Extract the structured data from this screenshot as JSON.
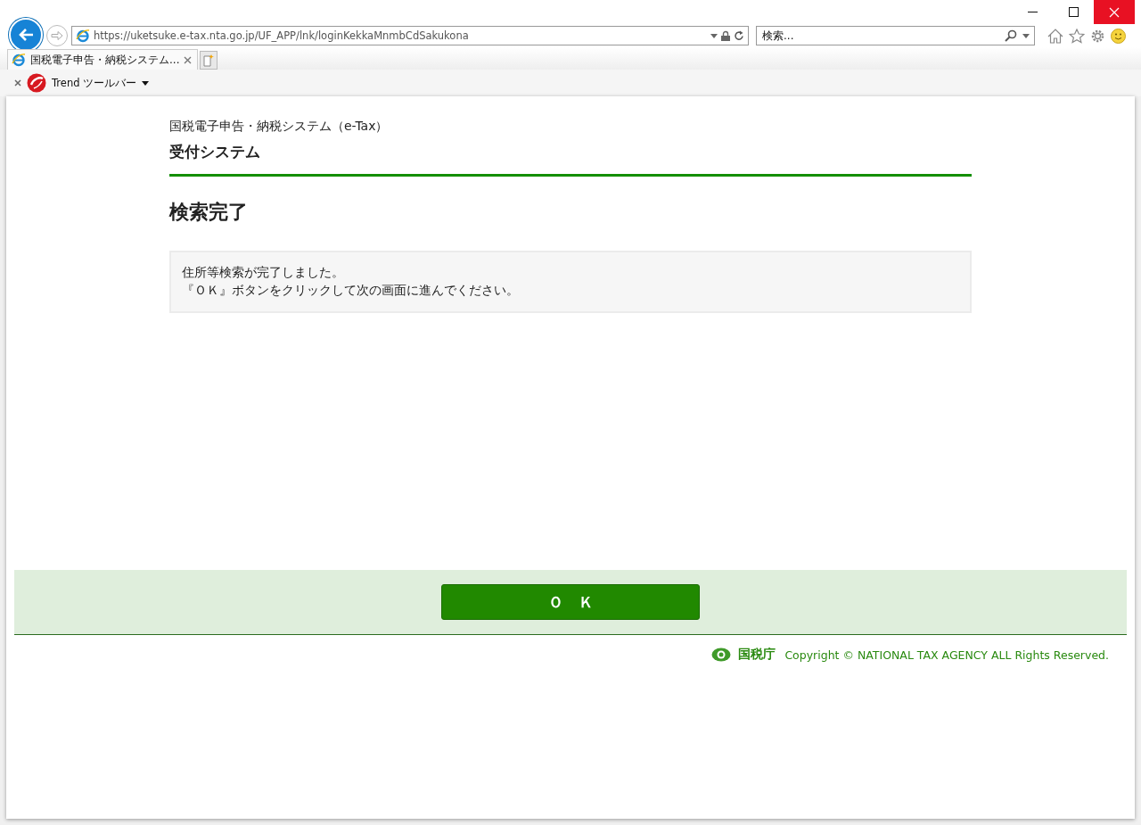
{
  "browser": {
    "url": "https://uketsuke.e-tax.nta.go.jp/UF_APP/lnk/loginKekkaMnmbCdSakukona",
    "search": {
      "placeholder": "検索..."
    },
    "tabs": [
      {
        "label": "国税電子申告・納税システム...",
        "selected": true
      }
    ],
    "toolbar": {
      "label": "Trend ツールバー"
    }
  },
  "page": {
    "system_name": "国税電子申告・納税システム（e-Tax）",
    "subsystem": "受付システム",
    "heading": "検索完了",
    "message": [
      "住所等検索が完了しました。",
      "『ＯＫ』ボタンをクリックして次の画面に進んでください。"
    ],
    "ok_button": "Ｏ　Ｋ",
    "footer": {
      "agency": "国税庁",
      "copyright": "Copyright © NATIONAL TAX AGENCY ALL Rights Reserved."
    }
  }
}
